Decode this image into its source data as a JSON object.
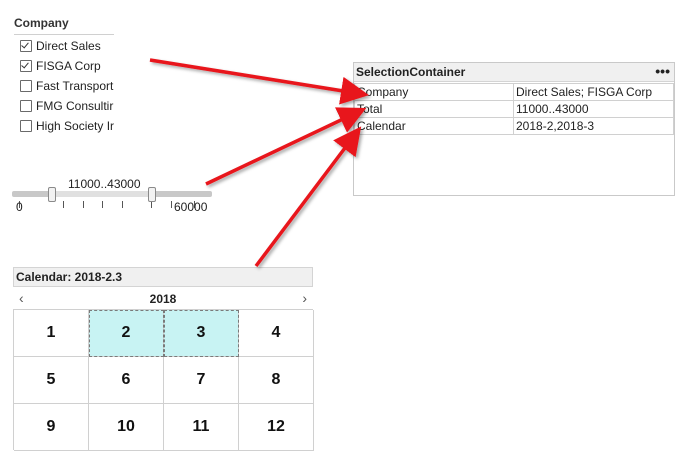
{
  "company": {
    "title": "Company",
    "items": [
      {
        "label": "Direct Sales",
        "checked": true
      },
      {
        "label": "FISGA Corp",
        "checked": true
      },
      {
        "label": "Fast Transport",
        "checked": false
      },
      {
        "label": "FMG Consultir",
        "checked": false
      },
      {
        "label": "High Society Ir",
        "checked": false
      }
    ]
  },
  "slider": {
    "value_label": "11000..43000",
    "min_label": "0",
    "max_label": "60000",
    "min": 0,
    "max": 60000,
    "low": 11000,
    "high": 43000
  },
  "selection_container": {
    "title": "SelectionContainer",
    "menu_icon": "more-horizontal-icon",
    "rows": [
      {
        "field": "Company",
        "value": "Direct Sales; FISGA Corp"
      },
      {
        "field": "Total",
        "value": "11000..43000"
      },
      {
        "field": "Calendar",
        "value": "2018-2,2018-3"
      }
    ]
  },
  "calendar": {
    "title": "Calendar: 2018-2.3",
    "year": "2018",
    "prev_icon": "chevron-left-icon",
    "next_icon": "chevron-right-icon",
    "months": [
      "1",
      "2",
      "3",
      "4",
      "5",
      "6",
      "7",
      "8",
      "9",
      "10",
      "11",
      "12"
    ],
    "selected_months": [
      "2",
      "3"
    ]
  },
  "colors": {
    "arrow": "#e8131a",
    "selected_cell": "#c8f3f3"
  }
}
